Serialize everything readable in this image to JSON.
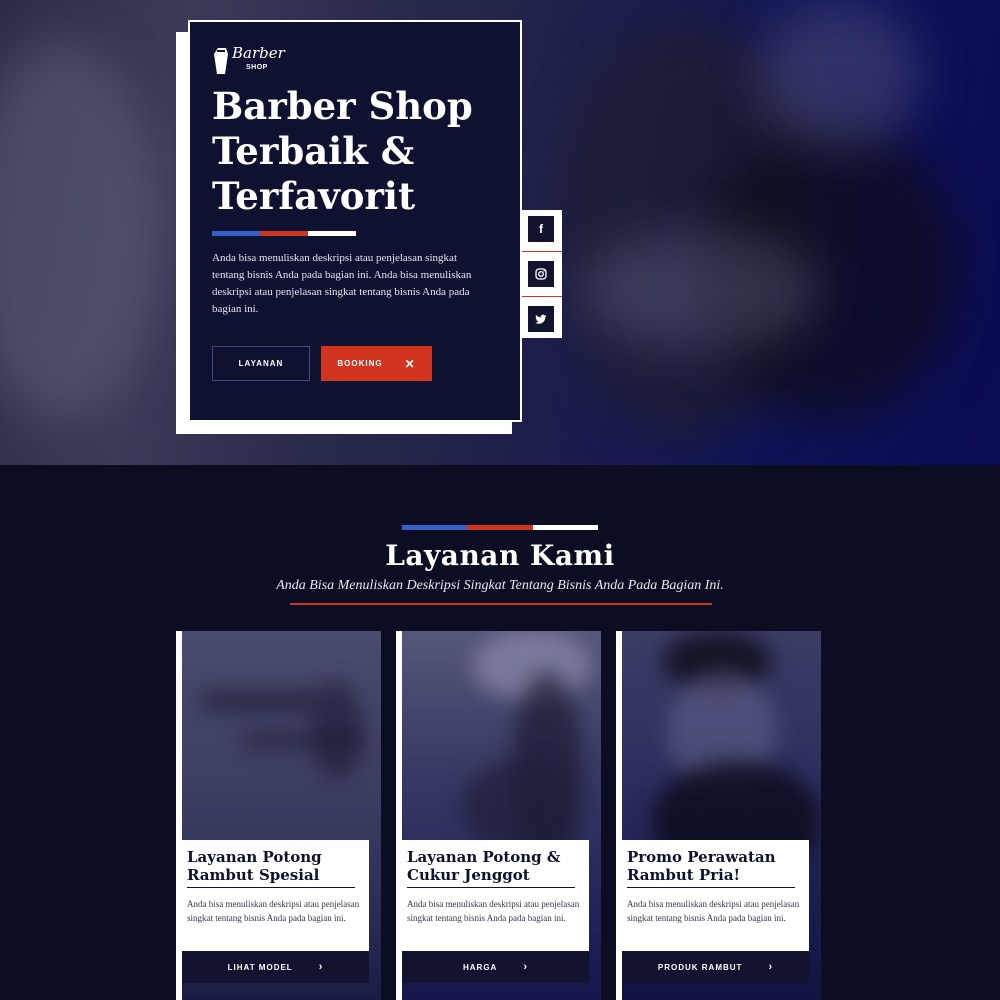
{
  "brand": {
    "logo_script": "Barber",
    "logo_sub": "SHOP"
  },
  "hero": {
    "title": "Barber Shop Terbaik & Terfavorit",
    "description": "Anda bisa menuliskan deskripsi atau penjelasan singkat tentang bisnis Anda pada bagian ini. Anda bisa menuliskan deskripsi atau penjelasan singkat tentang bisnis Anda pada bagian ini.",
    "btn_layanan": "LAYANAN",
    "btn_booking": "BOOKING",
    "btn_booking_icon": "✕"
  },
  "social": [
    {
      "icon": "facebook-icon",
      "glyph": "f"
    },
    {
      "icon": "instagram-icon",
      "glyph": "◎"
    },
    {
      "icon": "twitter-icon",
      "glyph": "🐦"
    }
  ],
  "services_section": {
    "title": "Layanan Kami",
    "subtitle": "Anda Bisa Menuliskan Deskripsi Singkat Tentang Bisnis Anda Pada Bagian Ini.",
    "cards": [
      {
        "title": "Layanan Potong Rambut Spesial",
        "description": "Anda bisa menuliskan deskripsi atau penjelasan singkat tentang bisnis Anda pada bagian ini.",
        "button": "LIHAT MODEL",
        "button_icon": "›"
      },
      {
        "title": "Layanan Potong & Cukur Jenggot",
        "description": "Anda bisa menuliskan deskripsi atau penjelasan singkat tentang bisnis Anda pada bagian ini.",
        "button": "HARGA",
        "button_icon": "›"
      },
      {
        "title": "Promo Perawatan Rambut Pria!",
        "description": "Anda bisa menuliskan deskripsi atau penjelasan singkat tentang bisnis Anda pada bagian ini.",
        "button": "PRODUK RAMBUT",
        "button_icon": "›"
      }
    ]
  },
  "colors": {
    "navy": "#0f1130",
    "red": "#d2351f",
    "blue": "#3461c7",
    "white": "#ffffff"
  }
}
